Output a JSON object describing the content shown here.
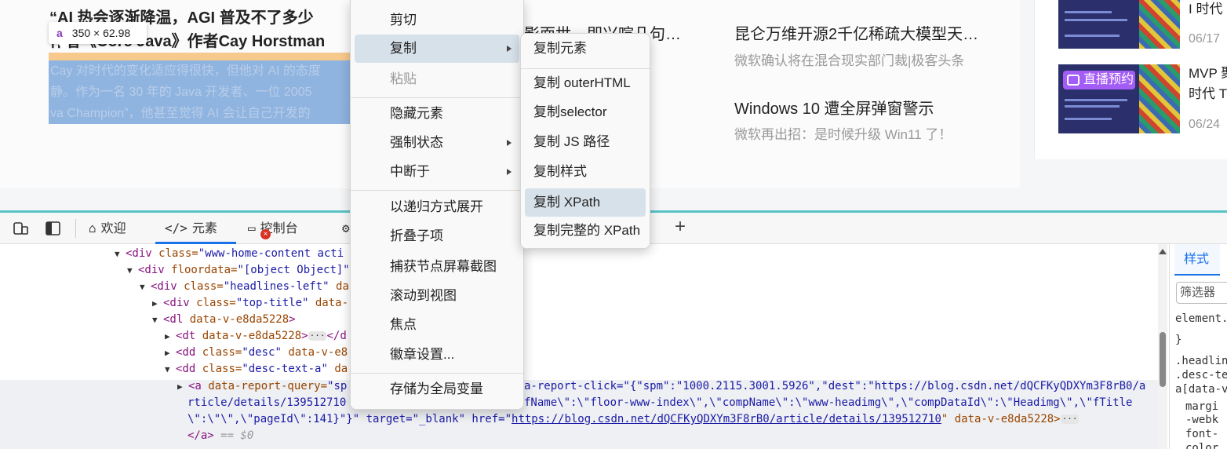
{
  "page": {
    "headline_line1": "“AI 热会逐渐降温，AGI 普及不了多少",
    "headline_line2": "作者《Core Java》作者Cay Horstman",
    "desc_lines": [
      "Cay 对时代的变化适应得很快，但他对 AI 的态度",
      "静。作为一名 30 年的 Java 开发者、一位 2005",
      "va Champion”，他甚至觉得 AI 会让自己开发的"
    ],
    "middle_snippet": "影面世，即兴喧几句…",
    "news": [
      {
        "title": "昆仑万维开源2千亿稀疏大模型天…",
        "subtitle": "微软确认将在混合现实部门裁|极客头条"
      },
      {
        "title": "Windows 10 遭全屏弹窗警示",
        "subtitle": "微软再出招：是时候升级 Win11 了！"
      }
    ],
    "side_items": [
      {
        "title_lines": [
          "I 时代"
        ],
        "date": "06/17"
      },
      {
        "title_lines": [
          "MVP 聚",
          "时代 T"
        ],
        "date": "06/24",
        "badge": "直播预约"
      }
    ]
  },
  "tooltip": {
    "tag": "a",
    "size": "350 × 62.98"
  },
  "devtools": {
    "tabs": [
      {
        "icon": "⌂",
        "label": "欢迎"
      },
      {
        "icon": "</>",
        "label": "元素"
      },
      {
        "icon": "▭",
        "label": "控制台"
      }
    ],
    "error_count": "×",
    "plus": "+",
    "styles_tab": "样式",
    "filter_placeholder": "筛选器",
    "styles_lines": [
      "element.",
      "}",
      ".headlin",
      ".desc-te",
      "a[data-v",
      "margi",
      "-webk",
      "font-",
      "color"
    ],
    "dom": {
      "l1_tag": "<div",
      "l1_attr": " class=",
      "l1_val": "\"www-home-content acti",
      "l2_tag": "<div",
      "l2_attr": " floordata=",
      "l2_val": "\"[object Object]\"",
      "l3_tag": "<div",
      "l3_attr": " class=",
      "l3_val": "\"headlines-left\"",
      "l3_rest": " da",
      "l4_tag": "<div",
      "l4_attr": " class=",
      "l4_val": "\"top-title\"",
      "l4_rest": " data-",
      "l5_tag": "<dl",
      "l5_attr": " data-v-e8da5228",
      "l5_end": ">",
      "l6_tag": "<dt",
      "l6_attr": " data-v-e8da5228",
      "l6_end": ">",
      "l6_close": "</d",
      "l7_tag": "<dd",
      "l7_attr": " class=",
      "l7_val": "\"desc\"",
      "l7_rest": " data-v-e8",
      "l8_tag": "<dd",
      "l8_attr": " class=",
      "l8_val": "\"desc-text-a\"",
      "l8_rest": " da",
      "sel1_tag": "<a",
      "sel1_attr": " data-report-query=",
      "sel1_val": "\"sp",
      "sel1_right": "a-report-click=\"{\"spm\":\"1000.2115.3001.5926\",\"dest\":\"https://blog.csdn.net/dQCFKyQDXYm3F8rB0/a",
      "sel2_left": "rticle/details/139512710",
      "sel2_right": "fName\\\":\\\"floor-www-index\\\",\\\"compName\\\":\\\"www-headimg\\\",\\\"compDataId\\\":\\\"Headimg\\\",\\\"fTitle",
      "sel3": "\\\":\\\"\\\",\\\"pageId\\\":141}\"}\"  target=\"_blank\"  href=\"",
      "sel3_link": "https://blog.csdn.net/dQCFKyQDXYm3F8rB0/article/details/139512710",
      "sel3_rest": "\"  data-v-e8da5228>",
      "close_a": "</a>",
      "eq0": " == $0",
      "ellipsis": "···"
    }
  },
  "context_menu": {
    "items": [
      {
        "label": "剪切"
      },
      {
        "label": "复制",
        "submenu": true
      },
      {
        "label": "粘贴",
        "disabled": true
      },
      {
        "label": "隐藏元素"
      },
      {
        "label": "强制状态",
        "submenu": true
      },
      {
        "label": "中断于",
        "submenu": true
      },
      {
        "label": "以递归方式展开"
      },
      {
        "label": "折叠子项"
      },
      {
        "label": "捕获节点屏幕截图"
      },
      {
        "label": "滚动到视图"
      },
      {
        "label": "焦点"
      },
      {
        "label": "徽章设置..."
      },
      {
        "label": "存储为全局变量"
      }
    ]
  },
  "copy_submenu": {
    "items": [
      {
        "label": "复制元素"
      },
      {
        "label": "复制 outerHTML"
      },
      {
        "label": "复制selector"
      },
      {
        "label": "复制 JS 路径"
      },
      {
        "label": "复制样式"
      },
      {
        "label": "复制 XPath"
      },
      {
        "label": "复制完整的 XPath"
      }
    ]
  },
  "colors": {
    "accent": "#1a73e8",
    "teal": "#59c3c3",
    "live_badge": "#a35cf5",
    "selection": "#8fb4e0",
    "menu_hover": "#d7e1ea"
  }
}
